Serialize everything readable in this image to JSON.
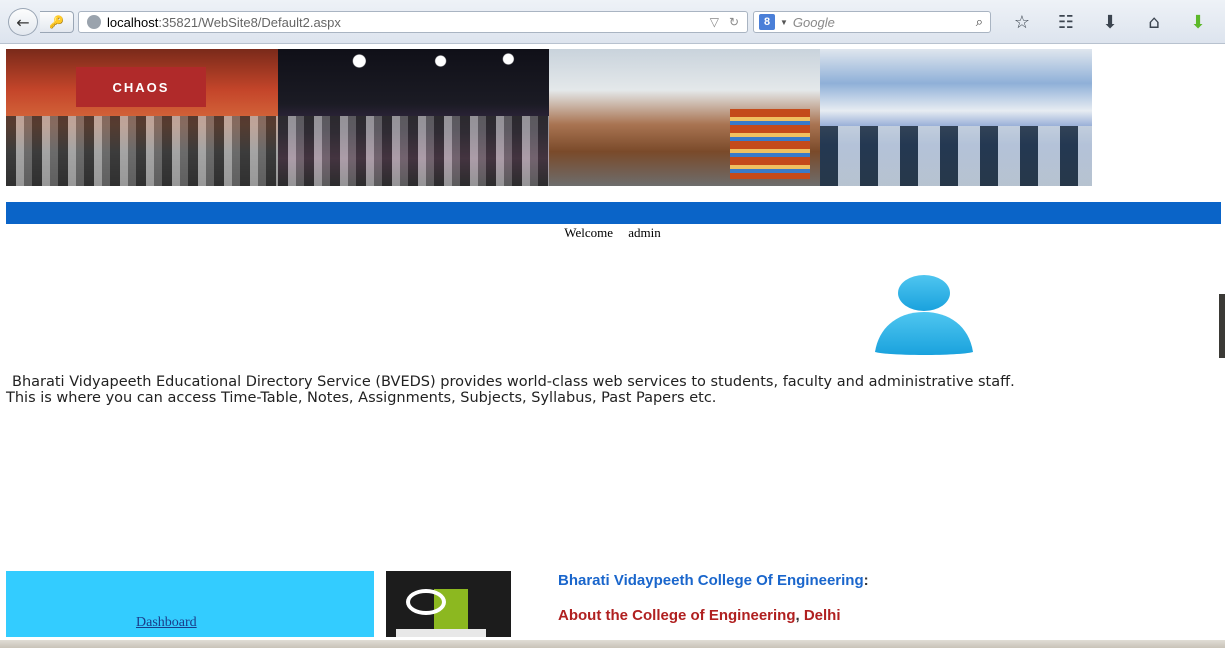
{
  "browser": {
    "url_host": "localhost",
    "url_path": ":35821/WebSite8/Default2.aspx",
    "search_placeholder": "Google",
    "search_engine_letter": "8"
  },
  "page": {
    "welcome_label": "Welcome",
    "username": "admin",
    "intro_line1": "Bharati Vidyapeeth Educational Directory Service (BVEDS) provides world-class web services to students, faculty and administrative staff.",
    "intro_line2": "This is where you can access Time-Table, Notes, Assignments, Subjects, Syllabus, Past Papers etc.",
    "dashboard_link": "Dashboard",
    "college_title": "Bharati Vidaypeeth College Of Engineering",
    "college_title_suffix": ":",
    "about_link_main": "About the College of Engineering",
    "about_link_sep": ",",
    "about_link_city": " Delhi"
  },
  "banner": {
    "img1_sign": "CHAOS"
  },
  "colors": {
    "nav_bar": "#0a64c8",
    "dashboard_bg": "#33ccff",
    "college_title": "#1a66cc",
    "about_link": "#b02020"
  }
}
